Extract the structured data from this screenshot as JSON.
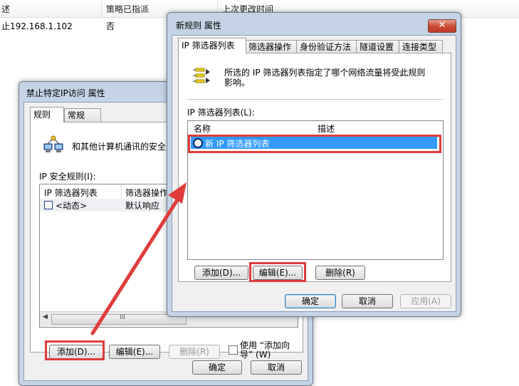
{
  "background_list": {
    "columns": [
      "述",
      "策略已指派",
      "上次更改时间"
    ],
    "row": {
      "name": "止192.168.1.102",
      "assigned": "否"
    }
  },
  "back_dialog": {
    "title": "禁止特定IP访问 属性",
    "tabs": [
      "规则",
      "常规"
    ],
    "description": "和其他计算机通讯的安全",
    "rules_label": "IP 安全规则(I):",
    "columns": [
      "IP 筛选器列表",
      "筛选器操作"
    ],
    "rows": [
      {
        "name": "<动态>",
        "action": "默认响应"
      }
    ],
    "buttons": {
      "add": "添加(D)...",
      "edit": "编辑(E)...",
      "remove": "删除(R)",
      "wizard_line1": "使用 “添加向",
      "wizard_line2": "导” (W)"
    },
    "ok": "确定",
    "cancel": "取消",
    "scroll_grip": "III"
  },
  "front_dialog": {
    "title": "新规则 属性",
    "close_glyph": "✕",
    "tabs": [
      "IP 筛选器列表",
      "筛选器操作",
      "身份验证方法",
      "隧道设置",
      "连接类型"
    ],
    "description_line1": "所选的 IP 筛选器列表指定了哪个网络流量将受此规则",
    "description_line2": "影响。",
    "list_label": "IP 筛选器列表(L):",
    "columns": [
      "名称",
      "描述"
    ],
    "rows": [
      {
        "name": "新 IP 筛选器列表",
        "description": ""
      }
    ],
    "buttons": {
      "add": "添加(D)...",
      "edit": "编辑(E)...",
      "remove": "删除(R)"
    },
    "ok": "确定",
    "cancel": "取消",
    "apply": "应用(A)"
  },
  "colors": {
    "highlight_red": "#e03c3c",
    "selection_blue": "#3399ff",
    "window_frame": "#c4d4e6"
  }
}
